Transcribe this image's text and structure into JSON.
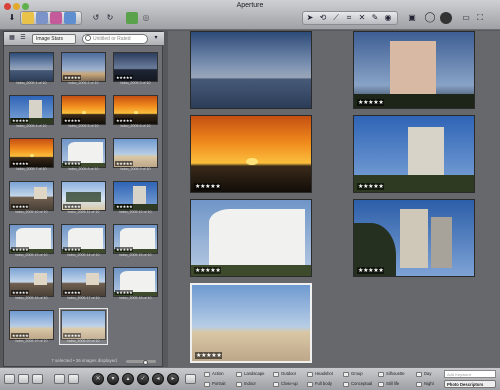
{
  "window": {
    "title": "Aperture"
  },
  "browser": {
    "filter_label": "Image Stars",
    "search_placeholder": "Untitled or Rated",
    "status": "7 selected • 36 images displayed",
    "thumbnails": [
      {
        "caption": "bobo_2005 1 of 10",
        "rating": "",
        "scene": "dusk"
      },
      {
        "caption": "bobo_2005 2 of 10",
        "rating": "★★★★★",
        "scene": "beach-sky"
      },
      {
        "caption": "bobo_2005 3 of 10",
        "rating": "★★★★★",
        "scene": "beach-dark"
      },
      {
        "caption": "bobo_2005 4 of 10",
        "rating": "★★★★★",
        "scene": "building-blue"
      },
      {
        "caption": "bobo_2005 5 of 10",
        "rating": "★★★★★",
        "scene": "sunset"
      },
      {
        "caption": "bobo_2005 6 of 10",
        "rating": "★★★★★",
        "scene": "sunset"
      },
      {
        "caption": "bobo_2005 7 of 10",
        "rating": "★★★★★",
        "scene": "sunset"
      },
      {
        "caption": "bobo_2005 8 of 10",
        "rating": "★★★★★",
        "scene": "building-white"
      },
      {
        "caption": "bobo_2005 9 of 10",
        "rating": "★★★★★",
        "scene": "beach"
      },
      {
        "caption": "bobo_2005 10 of 10",
        "rating": "★★★★★",
        "scene": "street"
      },
      {
        "caption": "bobo_2005 11 of 10",
        "rating": "★★★★★",
        "scene": "palms"
      },
      {
        "caption": "bobo_2005 12 of 10",
        "rating": "★★★★★",
        "scene": "building-blue"
      },
      {
        "caption": "bobo_2005 13 of 10",
        "rating": "★★★★★",
        "scene": "building-white"
      },
      {
        "caption": "bobo_2005 14 of 10",
        "rating": "★★★★★",
        "scene": "building-white"
      },
      {
        "caption": "bobo_2005 15 of 10",
        "rating": "★★★★★",
        "scene": "building-white"
      },
      {
        "caption": "bobo_2005 16 of 10",
        "rating": "★★★★★",
        "scene": "street"
      },
      {
        "caption": "bobo_2005 17 of 10",
        "rating": "★★★★★",
        "scene": "street"
      },
      {
        "caption": "bobo_2005 18 of 10",
        "rating": "★★★★★",
        "scene": "building-white"
      },
      {
        "caption": "bobo_2005 19 of 10",
        "rating": "★★★★★",
        "scene": "beach"
      },
      {
        "caption": "bobo_2005 20 of 10",
        "rating": "★★★★★",
        "scene": "beach"
      }
    ]
  },
  "viewer": {
    "images": [
      {
        "rating": "",
        "scene": "dusk"
      },
      {
        "rating": "★★★★★",
        "scene": "hotel-night"
      },
      {
        "rating": "★★★★★",
        "scene": "sunset"
      },
      {
        "rating": "★★★★★",
        "scene": "building-blue"
      },
      {
        "rating": "★★★★★",
        "scene": "building-white"
      },
      {
        "rating": "★★★★★",
        "scene": "towers"
      },
      {
        "rating": "★★★★★",
        "scene": "beach"
      }
    ]
  },
  "keywords": {
    "row1": [
      "Action",
      "Landscape",
      "Outdoor",
      "Headshot",
      "Group",
      "Silhouette",
      "Day"
    ],
    "row2": [
      "Portrait",
      "Indoor",
      "Close-up",
      "Full body",
      "Conceptual",
      "Still life",
      "Night"
    ],
    "add_placeholder": "Add Keyword",
    "preset": "Photo Descriptors"
  },
  "colors": {
    "selection": "#f0f0f0",
    "panel": "#6e7075",
    "viewer": "#67686c"
  }
}
